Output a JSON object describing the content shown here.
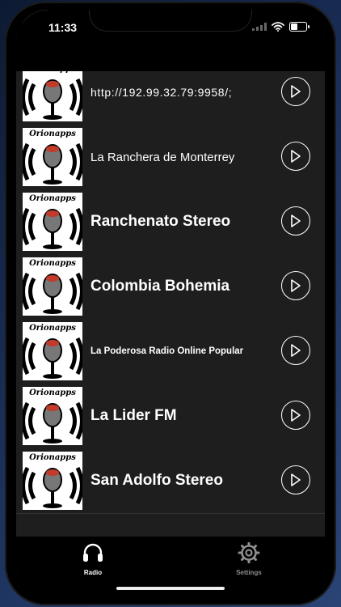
{
  "status_bar": {
    "time": "11:33"
  },
  "stations": [
    {
      "title": "http://192.99.32.79:9958/;",
      "thumbnail_brand": "Orionapps"
    },
    {
      "title": "La Ranchera de Monterrey",
      "thumbnail_brand": "Orionapps"
    },
    {
      "title": "Ranchenato Stereo",
      "thumbnail_brand": "Orionapps"
    },
    {
      "title": "Colombia Bohemia",
      "thumbnail_brand": "Orionapps"
    },
    {
      "title": "La Poderosa Radio Online Popular",
      "thumbnail_brand": "Orionapps"
    },
    {
      "title": "La Lider FM",
      "thumbnail_brand": "Orionapps"
    },
    {
      "title": "San Adolfo Stereo",
      "thumbnail_brand": "Orionapps"
    }
  ],
  "tab_bar": {
    "tabs": [
      {
        "label": "Radio",
        "icon": "headphones-icon",
        "active": true
      },
      {
        "label": "Settings",
        "icon": "gear-icon",
        "active": false
      }
    ]
  },
  "colors": {
    "background": "#1e1e1e",
    "tab_active": "#ffffff",
    "tab_inactive": "#8e8e8e"
  }
}
